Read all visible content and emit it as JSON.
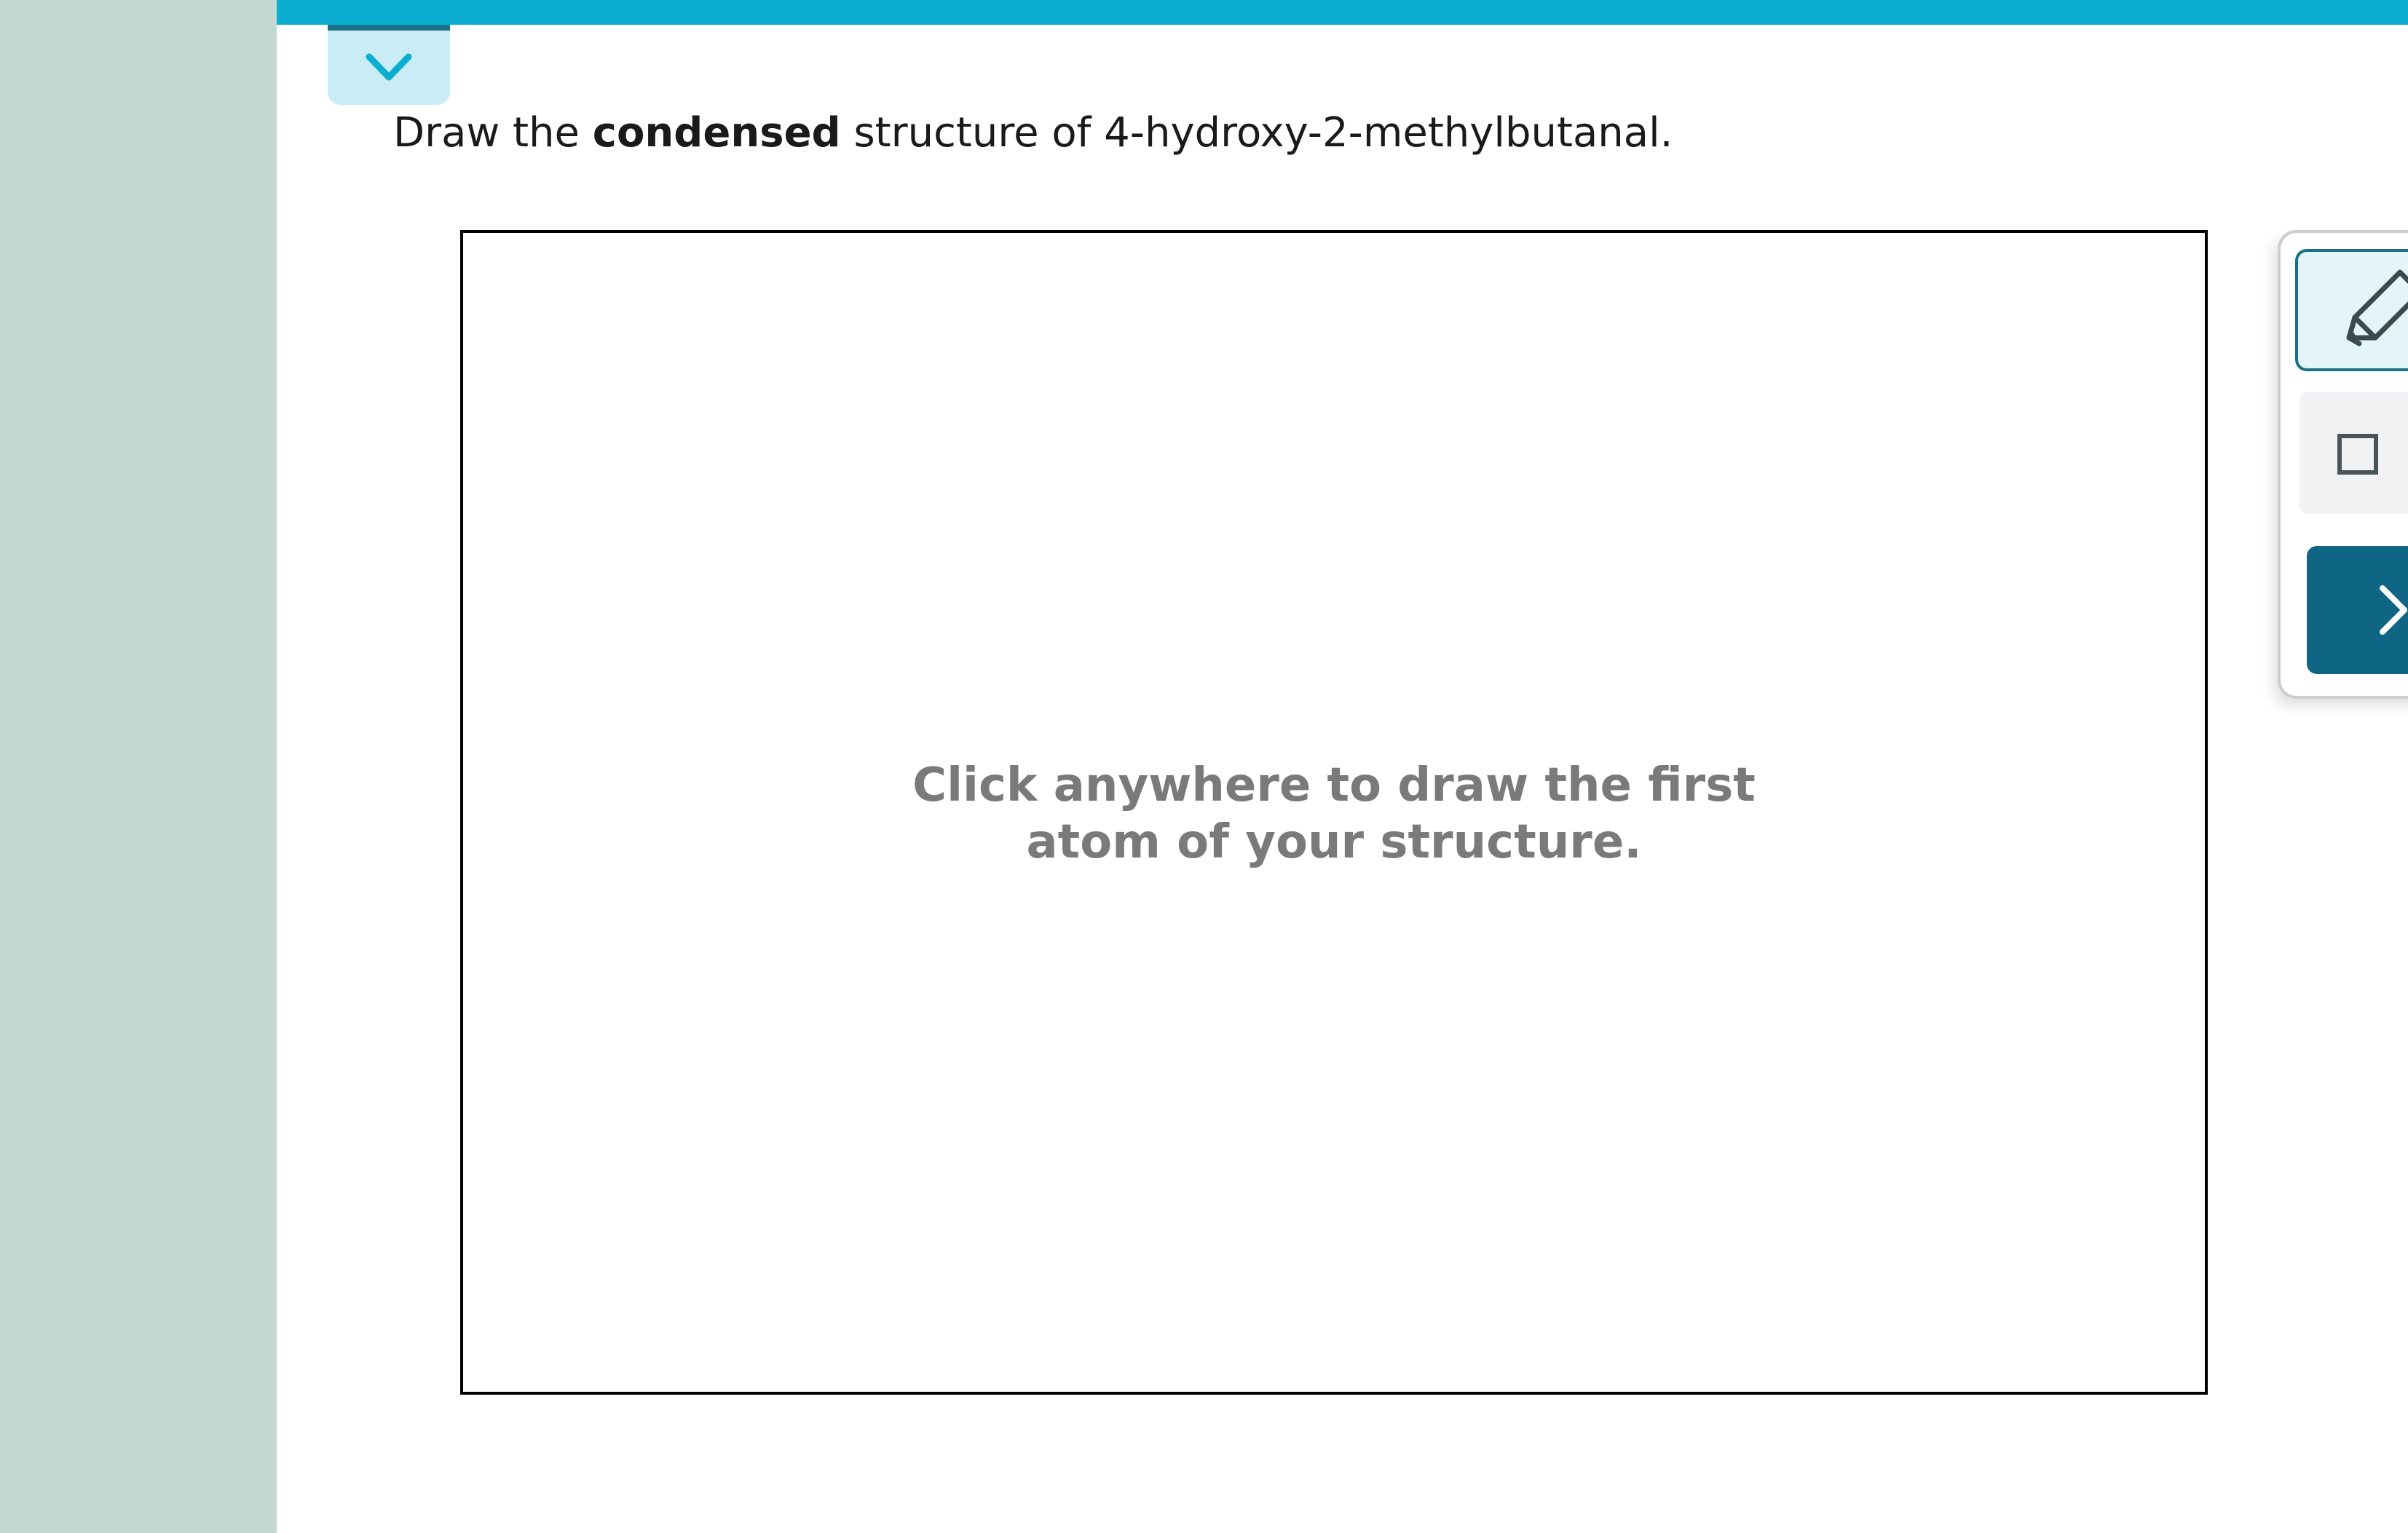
{
  "question": {
    "prefix": "Draw the ",
    "emphasis": "condensed",
    "suffix": " structure of 4-hydroxy-2-methylbutanal."
  },
  "canvas": {
    "hint_line1": "Click anywhere to draw the first",
    "hint_line2": "atom of your structure."
  },
  "toolbar": {
    "tools": [
      "pencil-icon",
      "square-icon",
      "chevron-right-icon"
    ]
  },
  "colors": {
    "accent_bar": "#0badd0",
    "left_strip": "#c1d9d1",
    "dark_teal": "#1d6f85",
    "next_button": "#0e6684"
  }
}
